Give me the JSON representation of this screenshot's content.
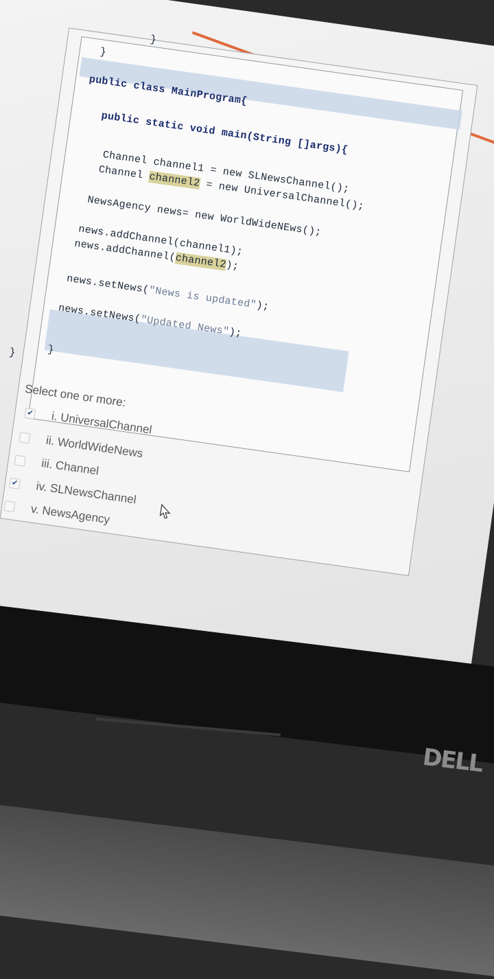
{
  "code": {
    "closing_brace_1": "}",
    "closing_brace_2": "}",
    "class_decl_kw": "public class",
    "class_name": "MainProgram{",
    "main_decl_kw": "public static void",
    "main_decl_rest": "main(String []args){",
    "line_channel1": "Channel channel1 = new SLNewsChannel();",
    "line_channel2_a": "Channel ",
    "line_channel2_var": "channel2",
    "line_channel2_b": " = new UniversalChannel();",
    "line_agency": "NewsAgency news= new WorldWideNEws();",
    "line_add1": "news.addChannel(channel1);",
    "line_add2_a": "news.addChannel(",
    "line_add2_var": "channel2",
    "line_add2_b": ");",
    "line_set1_a": "news.setNews(",
    "line_set1_str": "\"News is updated\"",
    "line_set1_b": ");",
    "line_set2_a": "news.setNews(",
    "line_set2_str": "\"Updated News\"",
    "line_set2_b": ");",
    "closing_brace_3": "}",
    "closing_brace_4": "}"
  },
  "question": {
    "prompt": "Select one or more:",
    "options": [
      {
        "label": "i. UniversalChannel",
        "checked": true
      },
      {
        "label": "ii. WorldWideNews",
        "checked": false
      },
      {
        "label": "iii. Channel",
        "checked": false
      },
      {
        "label": "iv. SLNewsChannel",
        "checked": true
      },
      {
        "label": "v. NewsAgency",
        "checked": false
      }
    ]
  },
  "laptop": {
    "brand": "DELL"
  },
  "colors": {
    "accent_line": "#e06a3a",
    "highlight": "#c9d6e8",
    "var_highlight": "#d8d19a"
  }
}
